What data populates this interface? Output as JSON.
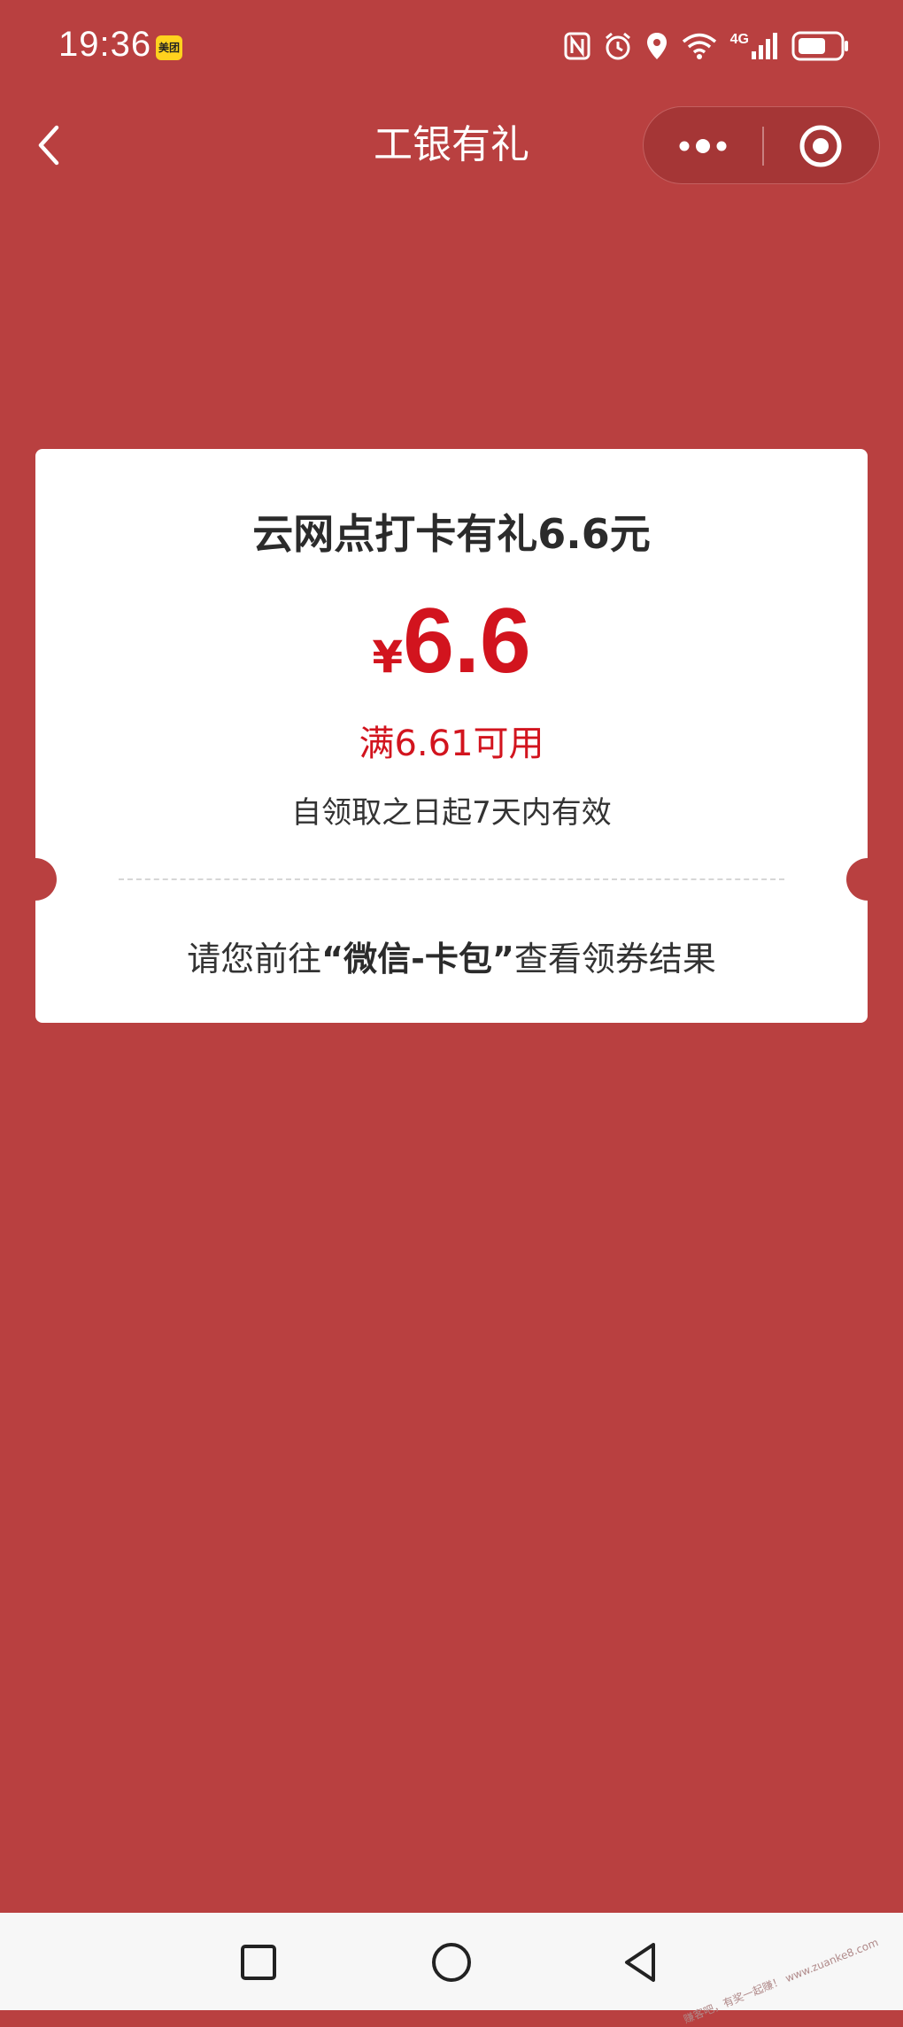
{
  "status_bar": {
    "time": "19:36",
    "app_badge": "美团",
    "network": "4G",
    "icons": [
      "nfc-icon",
      "alarm-icon",
      "location-icon",
      "wifi-icon",
      "signal-icon",
      "battery-icon"
    ]
  },
  "nav": {
    "title": "工银有礼",
    "back_icon": "chevron-left-icon",
    "more_icon": "more-dots-icon",
    "close_icon": "target-circle-icon"
  },
  "coupon": {
    "title": "云网点打卡有礼6.6元",
    "currency": "¥",
    "amount": "6.6",
    "threshold": "满6.61可用",
    "validity": "自领取之日起7天内有效",
    "hint_prefix": "请您前往",
    "hint_highlight": "“微信-卡包”",
    "hint_suffix": "查看领券结果"
  },
  "system_nav": {
    "recent_icon": "square-icon",
    "home_icon": "circle-icon",
    "back_icon": "triangle-back-icon"
  },
  "colors": {
    "background": "#b94040",
    "accent_red": "#d2141e",
    "card": "#ffffff"
  },
  "watermark": "赚客吧，有奖一起赚！ www.zuanke8.com"
}
